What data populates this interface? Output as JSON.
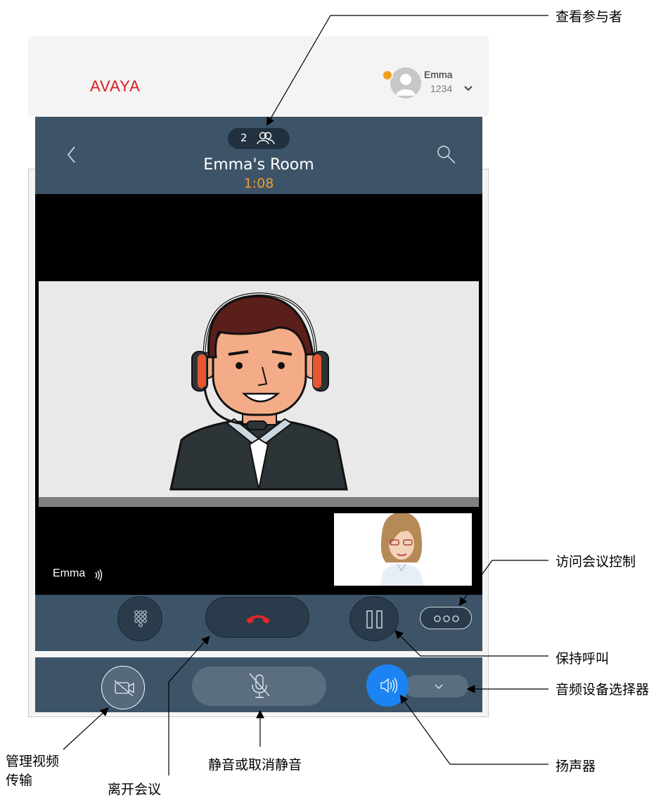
{
  "app": {
    "logo": "AVAYA",
    "user": {
      "name": "Emma",
      "extension": "1234"
    }
  },
  "call": {
    "participant_count": "2",
    "room_title": "Emma's Room",
    "timer": "1:08",
    "self_label": "Emma"
  },
  "callouts": {
    "participants": "查看参与者",
    "conference_controls": "访问会议控制",
    "hold": "保持呼叫",
    "audio_device": "音频设备选择器",
    "speaker": "扬声器",
    "mute": "静音或取消静音",
    "video_line1": "管理视频",
    "video_line2": "传输",
    "leave": "离开会议"
  },
  "colors": {
    "brand": "#d91b21",
    "header_bg": "#3d5468",
    "timer": "#f29a2e",
    "end_call": "#e8262a",
    "speaker_active": "#1b84f2",
    "presence": "#f0a01e"
  },
  "icons": [
    "back-icon",
    "search-icon",
    "participants-icon",
    "dialpad-icon",
    "end-call-icon",
    "pause-icon",
    "more-icon",
    "video-off-icon",
    "mic-off-icon",
    "speaker-icon",
    "chevron-down-icon",
    "audio-level-icon"
  ]
}
